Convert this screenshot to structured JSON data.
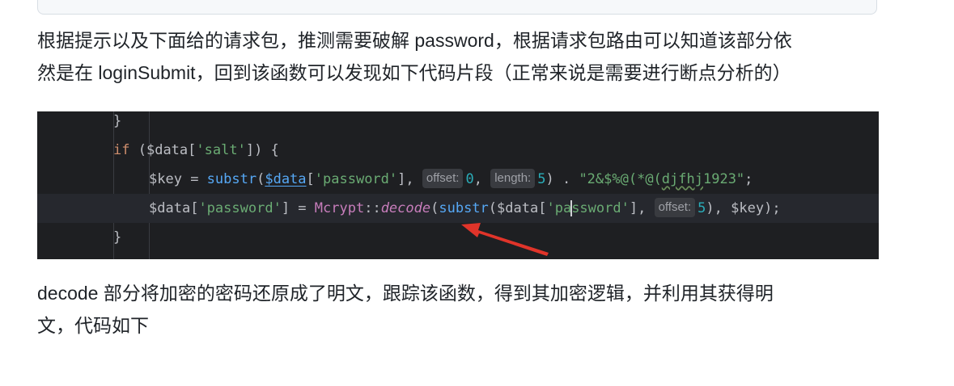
{
  "article": {
    "para1_line1": "根据提示以及下面给的请求包，推测需要破解 password，根据请求包路由可以知道该部分依",
    "para1_line2": "然是在 loginSubmit，回到该函数可以发现如下代码片段（正常来说是需要进行断点分析的）",
    "para2_line1": "decode 部分将加密的密码还原成了明文，跟踪该函数，得到其加密逻辑，并利用其获得明",
    "para2_line2": "文，代码如下"
  },
  "code": {
    "line1": {
      "brace": "}"
    },
    "line2": {
      "kw_if": "if",
      "open": " (",
      "var": "$data",
      "bracket_open": "[",
      "str": "'salt'",
      "close": "]) {"
    },
    "line3": {
      "var_key": "$key",
      "assign": " = ",
      "fn": "substr",
      "paren": "(",
      "var_data": "$data",
      "b1": "[",
      "str_pwd": "'password'",
      "b2": "], ",
      "hint_offset": "offset:",
      "num0": "0",
      "comma": ", ",
      "hint_length": "length:",
      "num5": "5",
      "close": ") . ",
      "str_salt_a": "\"2&$%@(*@(",
      "str_salt_b": "djfhj",
      "str_salt_c": "1923\"",
      "semi": ";"
    },
    "line4": {
      "var_data": "$data",
      "b1": "[",
      "str_pwd_a": "'pa",
      "str_pwd_b": "ssword'",
      "b2": "]",
      "assign": " = ",
      "cls": "Mcrypt",
      "dbl": "::",
      "method": "decode",
      "p1": "(",
      "fn": "substr",
      "p2": "(",
      "var_data2": "$data",
      "b3": "[",
      "str_pwd2_a": "'pa",
      "str_pwd2_b": "ssword'",
      "b4": "], ",
      "hint_offset": "offset:",
      "num5": "5",
      "close1": "), ",
      "var_key": "$key",
      "close2": ");"
    },
    "line5": {
      "brace": "}"
    }
  },
  "colors": {
    "code_bg": "#1e1f22",
    "current_line": "#26282e",
    "arrow": "#e0342a",
    "keyword": "#cf8e6d",
    "variable": "#c77dbb",
    "string": "#6aab73",
    "number": "#2aacb8",
    "function": "#56a8f5"
  }
}
